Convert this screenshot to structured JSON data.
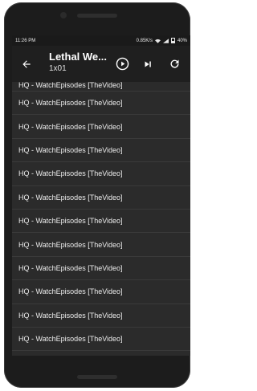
{
  "status_bar": {
    "time": "11:26 PM",
    "network_speed": "0.85K/s",
    "battery": "40%"
  },
  "toolbar": {
    "title": "Lethal We...",
    "subtitle": "1x01",
    "icons": {
      "back": "arrow-left",
      "play": "play-circle",
      "next": "skip-next",
      "refresh": "refresh"
    }
  },
  "list": {
    "items": [
      "HQ - WatchEpisodes [TheVideo]",
      "HQ - WatchEpisodes [TheVideo]",
      "HQ - WatchEpisodes [TheVideo]",
      "HQ - WatchEpisodes [TheVideo]",
      "HQ - WatchEpisodes [TheVideo]",
      "HQ - WatchEpisodes [TheVideo]",
      "HQ - WatchEpisodes [TheVideo]",
      "HQ - WatchEpisodes [TheVideo]",
      "HQ - WatchEpisodes [TheVideo]",
      "HQ - WatchEpisodes [TheVideo]",
      "HQ - WatchEpisodes [TheVideo]",
      "HQ - WatchEpisodes [TheVideo]"
    ]
  },
  "colors": {
    "background": "#2b2b2b",
    "toolbar": "#1f1f1f",
    "text": "#ececec"
  }
}
